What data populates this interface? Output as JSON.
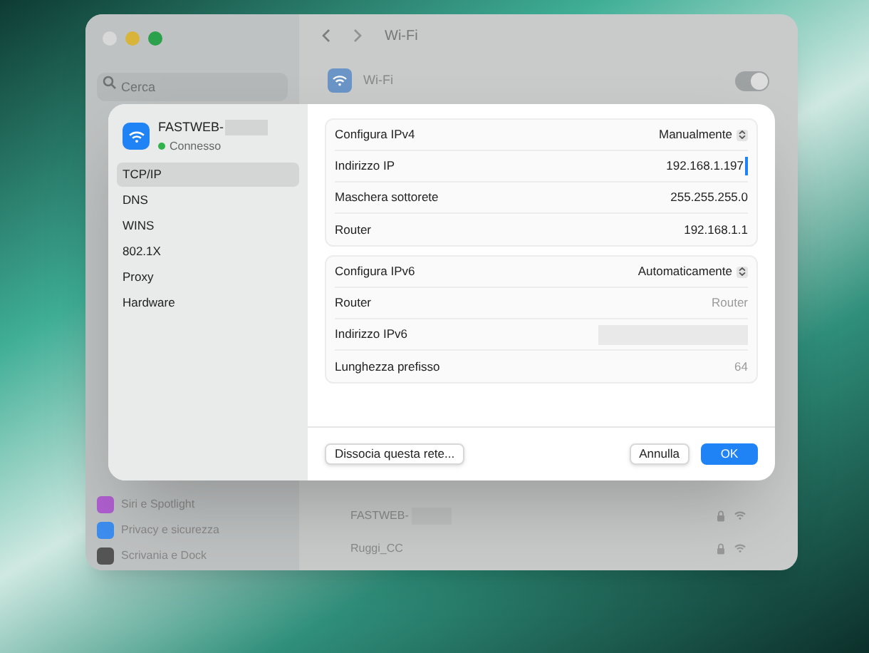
{
  "window": {
    "title": "Wi-Fi",
    "search": {
      "placeholder": "Cerca"
    }
  },
  "wifi_row": {
    "label": "Wi-Fi",
    "on": true
  },
  "sidebar": {
    "items": [
      {
        "label": "Siri e Spotlight",
        "color": "#b05fd0"
      },
      {
        "label": "Privacy e sicurezza",
        "color": "#3d8ef0"
      },
      {
        "label": "Scrivania e Dock",
        "color": "#555555"
      }
    ]
  },
  "networks": [
    {
      "name": "FASTWEB-",
      "masked": true
    },
    {
      "name": "Ruggi_CC",
      "masked": false
    }
  ],
  "dialog": {
    "network": {
      "name": "FASTWEB-",
      "status": "Connesso"
    },
    "tabs": [
      {
        "label": "TCP/IP",
        "selected": true
      },
      {
        "label": "DNS",
        "selected": false
      },
      {
        "label": "WINS",
        "selected": false
      },
      {
        "label": "802.1X",
        "selected": false
      },
      {
        "label": "Proxy",
        "selected": false
      },
      {
        "label": "Hardware",
        "selected": false
      }
    ],
    "groups": [
      [
        {
          "label": "Configura IPv4",
          "kind": "popup",
          "value": "Manualmente"
        },
        {
          "label": "Indirizzo IP",
          "kind": "field",
          "value": "192.168.1.197"
        },
        {
          "label": "Maschera sottorete",
          "kind": "text",
          "value": "255.255.255.0"
        },
        {
          "label": "Router",
          "kind": "text",
          "value": "192.168.1.1"
        }
      ],
      [
        {
          "label": "Configura IPv6",
          "kind": "popup",
          "value": "Automaticamente"
        },
        {
          "label": "Router",
          "kind": "placeholder",
          "placeholder": "Router"
        },
        {
          "label": "Indirizzo IPv6",
          "kind": "hidden"
        },
        {
          "label": "Lunghezza prefisso",
          "kind": "placeholder",
          "placeholder": "64"
        }
      ]
    ],
    "buttons": {
      "forget": "Dissocia questa rete...",
      "cancel": "Annulla",
      "ok": "OK"
    }
  }
}
